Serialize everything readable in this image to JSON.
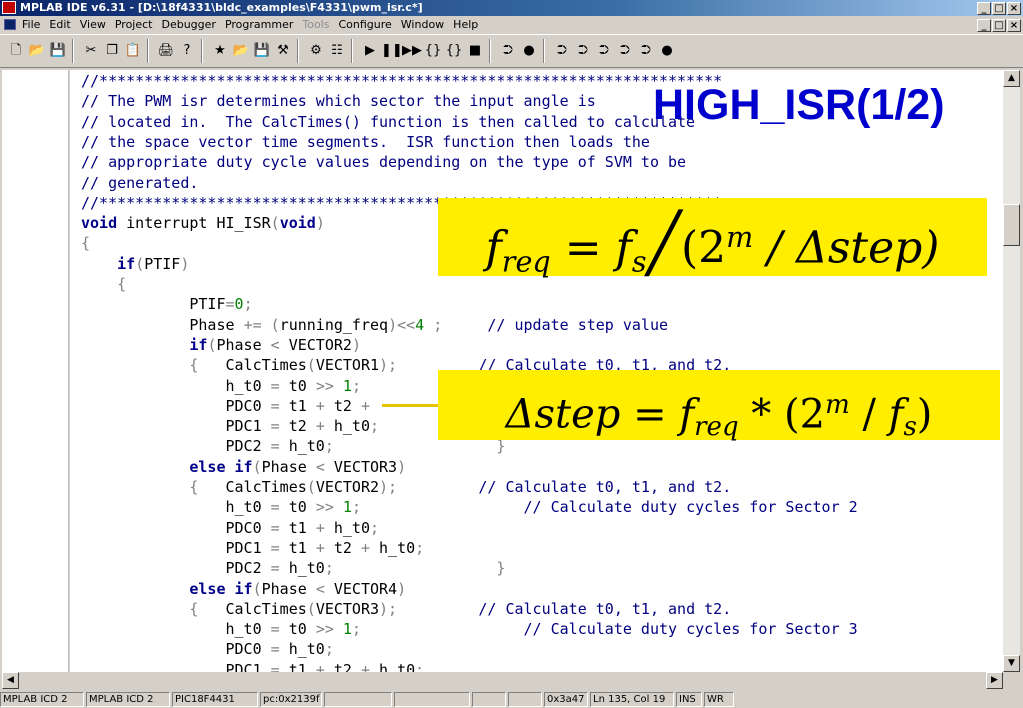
{
  "window": {
    "title": "MPLAB IDE v6.31 - [D:\\18f4331\\bldc_examples\\F4331\\pwm_isr.c*]",
    "controls": [
      "_",
      "□",
      "×"
    ]
  },
  "menu": {
    "items": [
      {
        "label": "File",
        "enabled": true
      },
      {
        "label": "Edit",
        "enabled": true
      },
      {
        "label": "View",
        "enabled": true
      },
      {
        "label": "Project",
        "enabled": true
      },
      {
        "label": "Debugger",
        "enabled": true
      },
      {
        "label": "Programmer",
        "enabled": true
      },
      {
        "label": "Tools",
        "enabled": false
      },
      {
        "label": "Configure",
        "enabled": true
      },
      {
        "label": "Window",
        "enabled": true
      },
      {
        "label": "Help",
        "enabled": true
      }
    ],
    "mdi_controls": [
      "_",
      "□",
      "×"
    ]
  },
  "toolbar": {
    "groups": [
      [
        "new-file-icon",
        "open-folder-icon",
        "save-icon"
      ],
      [
        "cut-icon",
        "copy-icon",
        "paste-icon"
      ],
      [
        "print-icon",
        "help-icon"
      ],
      [
        "new-project-icon",
        "open-project-icon",
        "save-project-icon",
        "build-icon"
      ],
      [
        "compile-icon",
        "make-icon"
      ],
      [
        "run-icon",
        "halt-icon",
        "animate-icon",
        "step-into-icon",
        "step-over-icon",
        "reset-icon"
      ],
      [
        "program-icon",
        "settings-icon"
      ],
      [
        "read-icon",
        "verify-icon",
        "erase-icon",
        "blank-check-icon",
        "release-icon",
        "connect-icon"
      ]
    ],
    "glyphs": {
      "new-file-icon": "🗋",
      "open-folder-icon": "📂",
      "save-icon": "💾",
      "cut-icon": "✂",
      "copy-icon": "❐",
      "paste-icon": "📋",
      "print-icon": "🖨",
      "help-icon": "?",
      "new-project-icon": "★",
      "open-project-icon": "📂",
      "save-project-icon": "💾",
      "build-icon": "⚒",
      "compile-icon": "⚙",
      "make-icon": "☷",
      "run-icon": "▶",
      "halt-icon": "❚❚",
      "animate-icon": "▶▶",
      "step-into-icon": "{}",
      "step-over-icon": "{}",
      "reset-icon": "■",
      "program-icon": "⮊",
      "settings-icon": "●",
      "read-icon": "⮊",
      "verify-icon": "⮊",
      "erase-icon": "⮊",
      "blank-check-icon": "⮊",
      "release-icon": "⮊",
      "connect-icon": "●"
    }
  },
  "editor": {
    "lines": [
      [
        {
          "t": "//*********************************************************************",
          "c": "cmt"
        }
      ],
      [
        {
          "t": "// The PWM isr determines which sector the input angle is",
          "c": "cmt"
        }
      ],
      [
        {
          "t": "// located in.  The CalcTimes() function is then called to calculate",
          "c": "cmt"
        }
      ],
      [
        {
          "t": "// the space vector time segments.  ISR function then loads the",
          "c": "cmt"
        }
      ],
      [
        {
          "t": "// appropriate duty cycle values depending on the type of SVM to be",
          "c": "cmt"
        }
      ],
      [
        {
          "t": "// generated.",
          "c": "cmt"
        }
      ],
      [
        {
          "t": "//*********************************************************************",
          "c": "cmt"
        }
      ],
      [
        {
          "t": "void",
          "c": "kw"
        },
        {
          "t": " interrupt HI_ISR",
          "c": ""
        },
        {
          "t": "(",
          "c": "op"
        },
        {
          "t": "void",
          "c": "kw"
        },
        {
          "t": ")",
          "c": "op"
        }
      ],
      [
        {
          "t": "{",
          "c": "op"
        }
      ],
      [
        {
          "t": "    ",
          "c": ""
        },
        {
          "t": "if",
          "c": "kw"
        },
        {
          "t": "(",
          "c": "op"
        },
        {
          "t": "PTIF",
          "c": ""
        },
        {
          "t": ")",
          "c": "op"
        }
      ],
      [
        {
          "t": "    {",
          "c": "op"
        }
      ],
      [
        {
          "t": "            PTIF",
          "c": ""
        },
        {
          "t": "=",
          "c": "op"
        },
        {
          "t": "0",
          "c": "num"
        },
        {
          "t": ";",
          "c": "op"
        }
      ],
      [
        {
          "t": "            Phase ",
          "c": ""
        },
        {
          "t": "+=",
          "c": "op"
        },
        {
          "t": " ",
          "c": ""
        },
        {
          "t": "(",
          "c": "op"
        },
        {
          "t": "running_freq",
          "c": ""
        },
        {
          "t": ")<<",
          "c": "op"
        },
        {
          "t": "4",
          "c": "num"
        },
        {
          "t": " ;     ",
          "c": "op"
        },
        {
          "t": "// update step value",
          "c": "cmt"
        }
      ],
      [
        {
          "t": "            ",
          "c": ""
        },
        {
          "t": "if",
          "c": "kw"
        },
        {
          "t": "(",
          "c": "op"
        },
        {
          "t": "Phase ",
          "c": ""
        },
        {
          "t": "<",
          "c": "op"
        },
        {
          "t": " VECTOR2",
          "c": ""
        },
        {
          "t": ")",
          "c": "op"
        }
      ],
      [
        {
          "t": "            {",
          "c": "op"
        },
        {
          "t": "   CalcTimes",
          "c": ""
        },
        {
          "t": "(",
          "c": "op"
        },
        {
          "t": "VECTOR1",
          "c": ""
        },
        {
          "t": ");",
          "c": "op"
        },
        {
          "t": "         // Calculate t0, t1, and t2.",
          "c": "cmt"
        }
      ],
      [
        {
          "t": "                h_t0 ",
          "c": ""
        },
        {
          "t": "=",
          "c": "op"
        },
        {
          "t": " t0 ",
          "c": ""
        },
        {
          "t": ">>",
          "c": "op"
        },
        {
          "t": " ",
          "c": ""
        },
        {
          "t": "1",
          "c": "num"
        },
        {
          "t": ";",
          "c": "op"
        }
      ],
      [
        {
          "t": "                PDC0 ",
          "c": ""
        },
        {
          "t": "=",
          "c": "op"
        },
        {
          "t": " t1 ",
          "c": ""
        },
        {
          "t": "+",
          "c": "op"
        },
        {
          "t": " t2 ",
          "c": ""
        },
        {
          "t": "+",
          "c": "op"
        }
      ],
      [
        {
          "t": "                PDC1 ",
          "c": ""
        },
        {
          "t": "=",
          "c": "op"
        },
        {
          "t": " t2 ",
          "c": ""
        },
        {
          "t": "+",
          "c": "op"
        },
        {
          "t": " h_t0",
          "c": ""
        },
        {
          "t": ";",
          "c": "op"
        }
      ],
      [
        {
          "t": "                PDC2 ",
          "c": ""
        },
        {
          "t": "=",
          "c": "op"
        },
        {
          "t": " h_t0",
          "c": ""
        },
        {
          "t": ";",
          "c": "op"
        },
        {
          "t": "                  }",
          "c": "op"
        }
      ],
      [
        {
          "t": "            ",
          "c": ""
        },
        {
          "t": "else if",
          "c": "kw"
        },
        {
          "t": "(",
          "c": "op"
        },
        {
          "t": "Phase ",
          "c": ""
        },
        {
          "t": "<",
          "c": "op"
        },
        {
          "t": " VECTOR3",
          "c": ""
        },
        {
          "t": ")",
          "c": "op"
        }
      ],
      [
        {
          "t": "            {",
          "c": "op"
        },
        {
          "t": "   CalcTimes",
          "c": ""
        },
        {
          "t": "(",
          "c": "op"
        },
        {
          "t": "VECTOR2",
          "c": ""
        },
        {
          "t": ");",
          "c": "op"
        },
        {
          "t": "         // Calculate t0, t1, and t2.",
          "c": "cmt"
        }
      ],
      [
        {
          "t": "                h_t0 ",
          "c": ""
        },
        {
          "t": "=",
          "c": "op"
        },
        {
          "t": " t0 ",
          "c": ""
        },
        {
          "t": ">>",
          "c": "op"
        },
        {
          "t": " ",
          "c": ""
        },
        {
          "t": "1",
          "c": "num"
        },
        {
          "t": ";",
          "c": "op"
        },
        {
          "t": "                  // Calculate duty cycles for Sector 2",
          "c": "cmt"
        }
      ],
      [
        {
          "t": "                PDC0 ",
          "c": ""
        },
        {
          "t": "=",
          "c": "op"
        },
        {
          "t": " t1 ",
          "c": ""
        },
        {
          "t": "+",
          "c": "op"
        },
        {
          "t": " h_t0",
          "c": ""
        },
        {
          "t": ";",
          "c": "op"
        }
      ],
      [
        {
          "t": "                PDC1 ",
          "c": ""
        },
        {
          "t": "=",
          "c": "op"
        },
        {
          "t": " t1 ",
          "c": ""
        },
        {
          "t": "+",
          "c": "op"
        },
        {
          "t": " t2 ",
          "c": ""
        },
        {
          "t": "+",
          "c": "op"
        },
        {
          "t": " h_t0",
          "c": ""
        },
        {
          "t": ";",
          "c": "op"
        }
      ],
      [
        {
          "t": "                PDC2 ",
          "c": ""
        },
        {
          "t": "=",
          "c": "op"
        },
        {
          "t": " h_t0",
          "c": ""
        },
        {
          "t": ";",
          "c": "op"
        },
        {
          "t": "                  }",
          "c": "op"
        }
      ],
      [
        {
          "t": "            ",
          "c": ""
        },
        {
          "t": "else if",
          "c": "kw"
        },
        {
          "t": "(",
          "c": "op"
        },
        {
          "t": "Phase ",
          "c": ""
        },
        {
          "t": "<",
          "c": "op"
        },
        {
          "t": " VECTOR4",
          "c": ""
        },
        {
          "t": ")",
          "c": "op"
        }
      ],
      [
        {
          "t": "            {",
          "c": "op"
        },
        {
          "t": "   CalcTimes",
          "c": ""
        },
        {
          "t": "(",
          "c": "op"
        },
        {
          "t": "VECTOR3",
          "c": ""
        },
        {
          "t": ");",
          "c": "op"
        },
        {
          "t": "         // Calculate t0, t1, and t2.",
          "c": "cmt"
        }
      ],
      [
        {
          "t": "                h_t0 ",
          "c": ""
        },
        {
          "t": "=",
          "c": "op"
        },
        {
          "t": " t0 ",
          "c": ""
        },
        {
          "t": ">>",
          "c": "op"
        },
        {
          "t": " ",
          "c": ""
        },
        {
          "t": "1",
          "c": "num"
        },
        {
          "t": ";",
          "c": "op"
        },
        {
          "t": "                  // Calculate duty cycles for Sector 3",
          "c": "cmt"
        }
      ],
      [
        {
          "t": "                PDC0 ",
          "c": ""
        },
        {
          "t": "=",
          "c": "op"
        },
        {
          "t": " h_t0",
          "c": ""
        },
        {
          "t": ";",
          "c": "op"
        }
      ],
      [
        {
          "t": "                PDC1 ",
          "c": ""
        },
        {
          "t": "=",
          "c": "op"
        },
        {
          "t": " t1 ",
          "c": ""
        },
        {
          "t": "+",
          "c": "op"
        },
        {
          "t": " t2 ",
          "c": ""
        },
        {
          "t": "+",
          "c": "op"
        },
        {
          "t": " h_t0",
          "c": ""
        },
        {
          "t": ";",
          "c": "op"
        }
      ]
    ]
  },
  "overlay": {
    "title": "HIGH_ISR(1/2)",
    "formula1": {
      "lhs": "f",
      "lhs_sub": "req",
      "eq": " = ",
      "a": "f",
      "a_sub": "s",
      "slash": "╱",
      "open": "(2",
      "exp": "m",
      "mid": " / Δstep)"
    },
    "formula2": {
      "lhs": "Δstep",
      "eq": " = ",
      "a": "f",
      "a_sub": "req",
      "mul": " * (2",
      "exp": "m",
      "mid": " / ",
      "b": "f",
      "b_sub": "s",
      "close": ")"
    }
  },
  "statusbar": [
    "MPLAB ICD 2",
    "MPLAB ICD 2",
    "PIC18F4431",
    "pc:0x2139f",
    "",
    "",
    "",
    "",
    "0x3a47",
    "Ln 135, Col 19",
    "INS",
    "WR"
  ],
  "colors": {
    "titlebar": "#0a246a",
    "comment": "#000080",
    "keyword": "#00008b",
    "number": "#008000",
    "highlight": "#ffee00",
    "overlay_title": "#0000cc"
  }
}
